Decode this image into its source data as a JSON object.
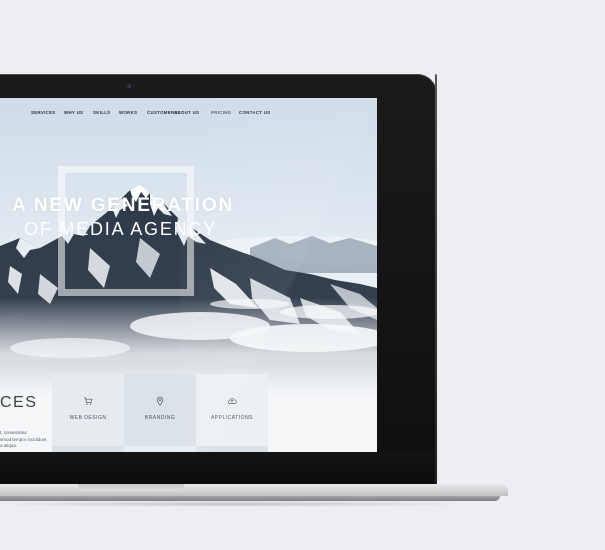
{
  "nav": {
    "items": [
      "SERVICES",
      "WHY US",
      "SKILLS",
      "WORKS",
      "CUSTOMERS",
      "ABOUT US",
      "PRICING",
      "CONTACT US"
    ]
  },
  "hero": {
    "title": "A NEW GENERATION",
    "subtitle": "OF MEDIA AGENCY"
  },
  "services": {
    "heading": "CES",
    "text_lines": [
      "t, consectetur",
      "smod tempor incididunt",
      "a aliqua."
    ],
    "tiles": [
      {
        "label": "WEB DESIGN",
        "icon": "cart-icon"
      },
      {
        "label": "BRANDING",
        "icon": "location-pin-icon"
      },
      {
        "label": "APPLICATIONS",
        "icon": "cloud-upload-icon"
      }
    ]
  },
  "colors": {
    "bezel": "#111112",
    "background": "#eceef1",
    "tile_light": "#e6ebef",
    "tile_dark": "#dbe2e8"
  }
}
